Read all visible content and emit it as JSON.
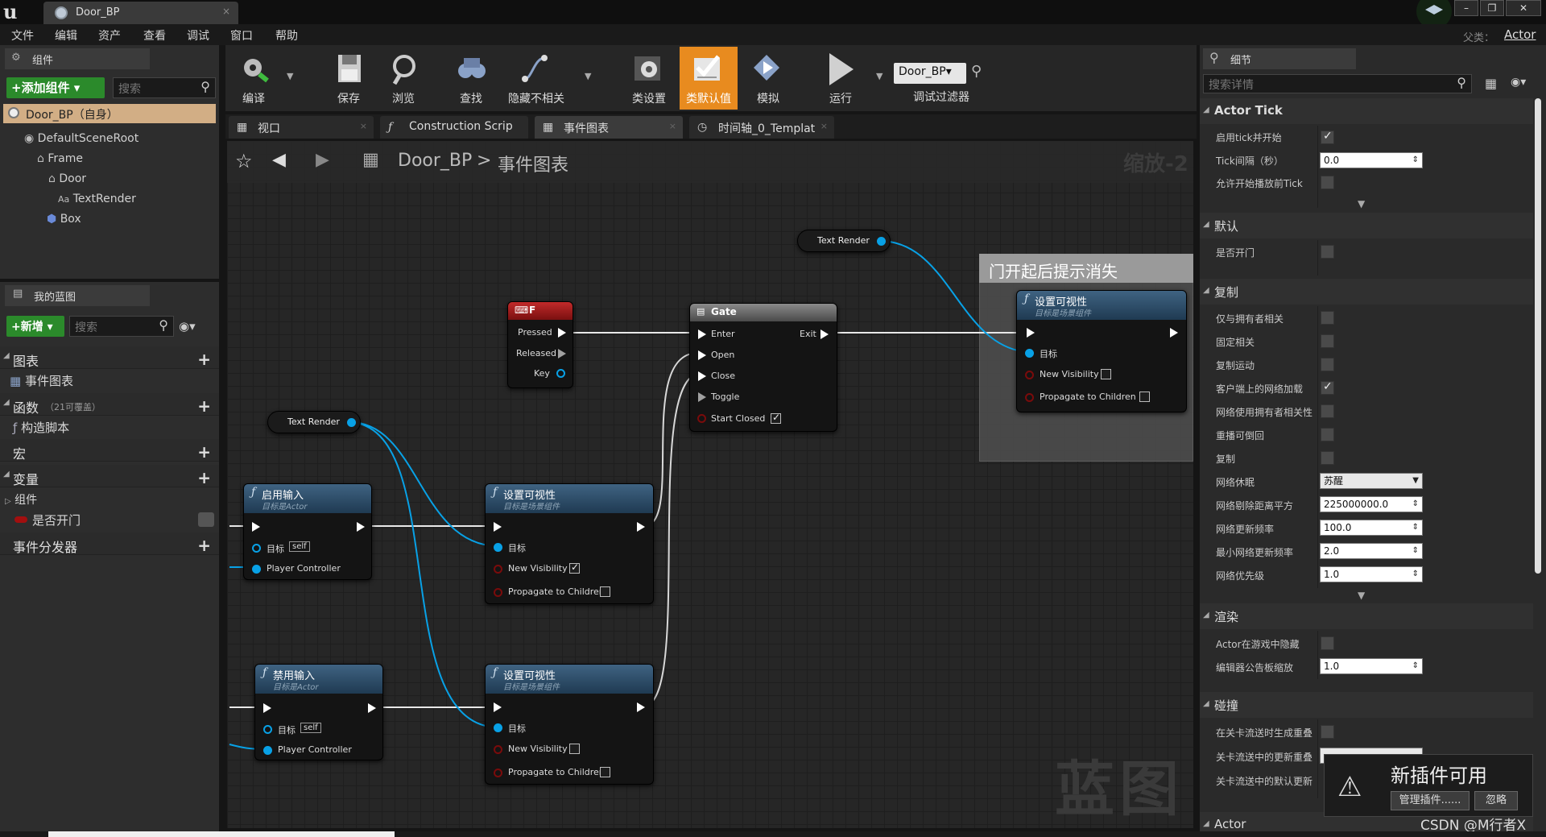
{
  "window": {
    "tab_title": "Door_BP",
    "parent_label": "父类：",
    "parent_value": "Actor"
  },
  "menu": [
    "文件",
    "编辑",
    "资产",
    "查看",
    "调试",
    "窗口",
    "帮助"
  ],
  "components_panel": {
    "tab": "组件",
    "add_button": "+添加组件 ▾",
    "search_placeholder": "搜索",
    "self_row": "Door_BP（自身）",
    "tree": [
      "DefaultSceneRoot",
      "Frame",
      "Door",
      "TextRender",
      "Box"
    ]
  },
  "my_blueprint": {
    "tab": "我的蓝图",
    "new_button": "+新增 ▾",
    "search_placeholder": "搜索",
    "categories": {
      "graphs": "图表",
      "event_graph": "事件图表",
      "functions": "函数",
      "functions_note": "（21可覆盖）",
      "construction": "构造脚本",
      "macros": "宏",
      "variables": "变量",
      "components": "组件",
      "var_is_open": "是否开门",
      "dispatchers": "事件分发器"
    }
  },
  "toolbar": {
    "compile": "编译",
    "save": "保存",
    "browse": "浏览",
    "find": "查找",
    "hide_unrelated": "隐藏不相关",
    "class_settings": "类设置",
    "class_defaults": "类默认值",
    "simulate": "模拟",
    "run": "运行",
    "debug_object": "Door_BP▾",
    "debug_filter": "调试过滤器"
  },
  "graph_tabs": [
    "视口",
    "Construction Scrip",
    "事件图表",
    "时间轴_0_Templat"
  ],
  "graph": {
    "breadcrumb_bp": "Door_BP",
    "breadcrumb_sep": ">",
    "breadcrumb_graph": "事件图表",
    "zoom": "缩放-2",
    "watermark": "蓝图",
    "comment": "门开起后提示消失",
    "nodes": {
      "key_f": {
        "title": "F",
        "pressed": "Pressed",
        "released": "Released",
        "key": "Key"
      },
      "gate": {
        "title": "Gate",
        "enter": "Enter",
        "exit": "Exit",
        "open": "Open",
        "close": "Close",
        "toggle": "Toggle",
        "start_closed": "Start Closed"
      },
      "text_render_1": "Text Render",
      "text_render_2": "Text Render",
      "enable_input": {
        "title": "启用输入",
        "sub": "目标是Actor",
        "target": "目标",
        "self": "self",
        "pc": "Player Controller"
      },
      "disable_input": {
        "title": "禁用输入",
        "sub": "目标是Actor",
        "target": "目标",
        "self": "self",
        "pc": "Player Controller"
      },
      "set_vis": {
        "title": "设置可视性",
        "sub": "目标是场景组件",
        "target": "目标",
        "new_vis": "New Visibility",
        "propagate": "Propagate to Children"
      }
    }
  },
  "details": {
    "tab": "细节",
    "search_placeholder": "搜索详情",
    "sections": {
      "actor_tick": "Actor Tick",
      "defaults": "默认",
      "replication": "复制",
      "rendering": "渲染",
      "collision": "碰撞",
      "actor": "Actor"
    },
    "tick": [
      {
        "label": "启用tick并开始",
        "checked": true
      },
      {
        "label": "Tick间隔（秒）",
        "value": "0.0"
      },
      {
        "label": "允许开始播放前Tick",
        "checked": false
      }
    ],
    "defaults": [
      {
        "label": "是否开门",
        "checked": false
      }
    ],
    "replication": [
      {
        "label": "仅与拥有者相关",
        "checked": false
      },
      {
        "label": "固定相关",
        "checked": false
      },
      {
        "label": "复制运动",
        "checked": false
      },
      {
        "label": "客户端上的网络加载",
        "checked": true
      },
      {
        "label": "网络使用拥有者相关性",
        "checked": false
      },
      {
        "label": "重播可倒回",
        "checked": false
      },
      {
        "label": "复制",
        "checked": false
      },
      {
        "label": "网络休眠",
        "value": "苏醒"
      },
      {
        "label": "网络剔除距离平方",
        "value": "225000000.0"
      },
      {
        "label": "网络更新频率",
        "value": "100.0"
      },
      {
        "label": "最小网络更新频率",
        "value": "2.0"
      },
      {
        "label": "网络优先级",
        "value": "1.0"
      }
    ],
    "rendering": [
      {
        "label": "Actor在游戏中隐藏",
        "checked": false
      },
      {
        "label": "编辑器公告板缩放",
        "value": "1.0"
      }
    ],
    "collision": [
      {
        "label": "在关卡流送时生成重叠",
        "checked": false
      },
      {
        "label": "关卡流送中的更新重叠",
        "value": ""
      },
      {
        "label": "关卡流送中的默认更新",
        "value": ""
      }
    ]
  },
  "toast": {
    "title": "新插件可用",
    "manage": "管理插件......",
    "ignore": "忽略"
  },
  "watermark_csdn": "CSDN @M行者X"
}
